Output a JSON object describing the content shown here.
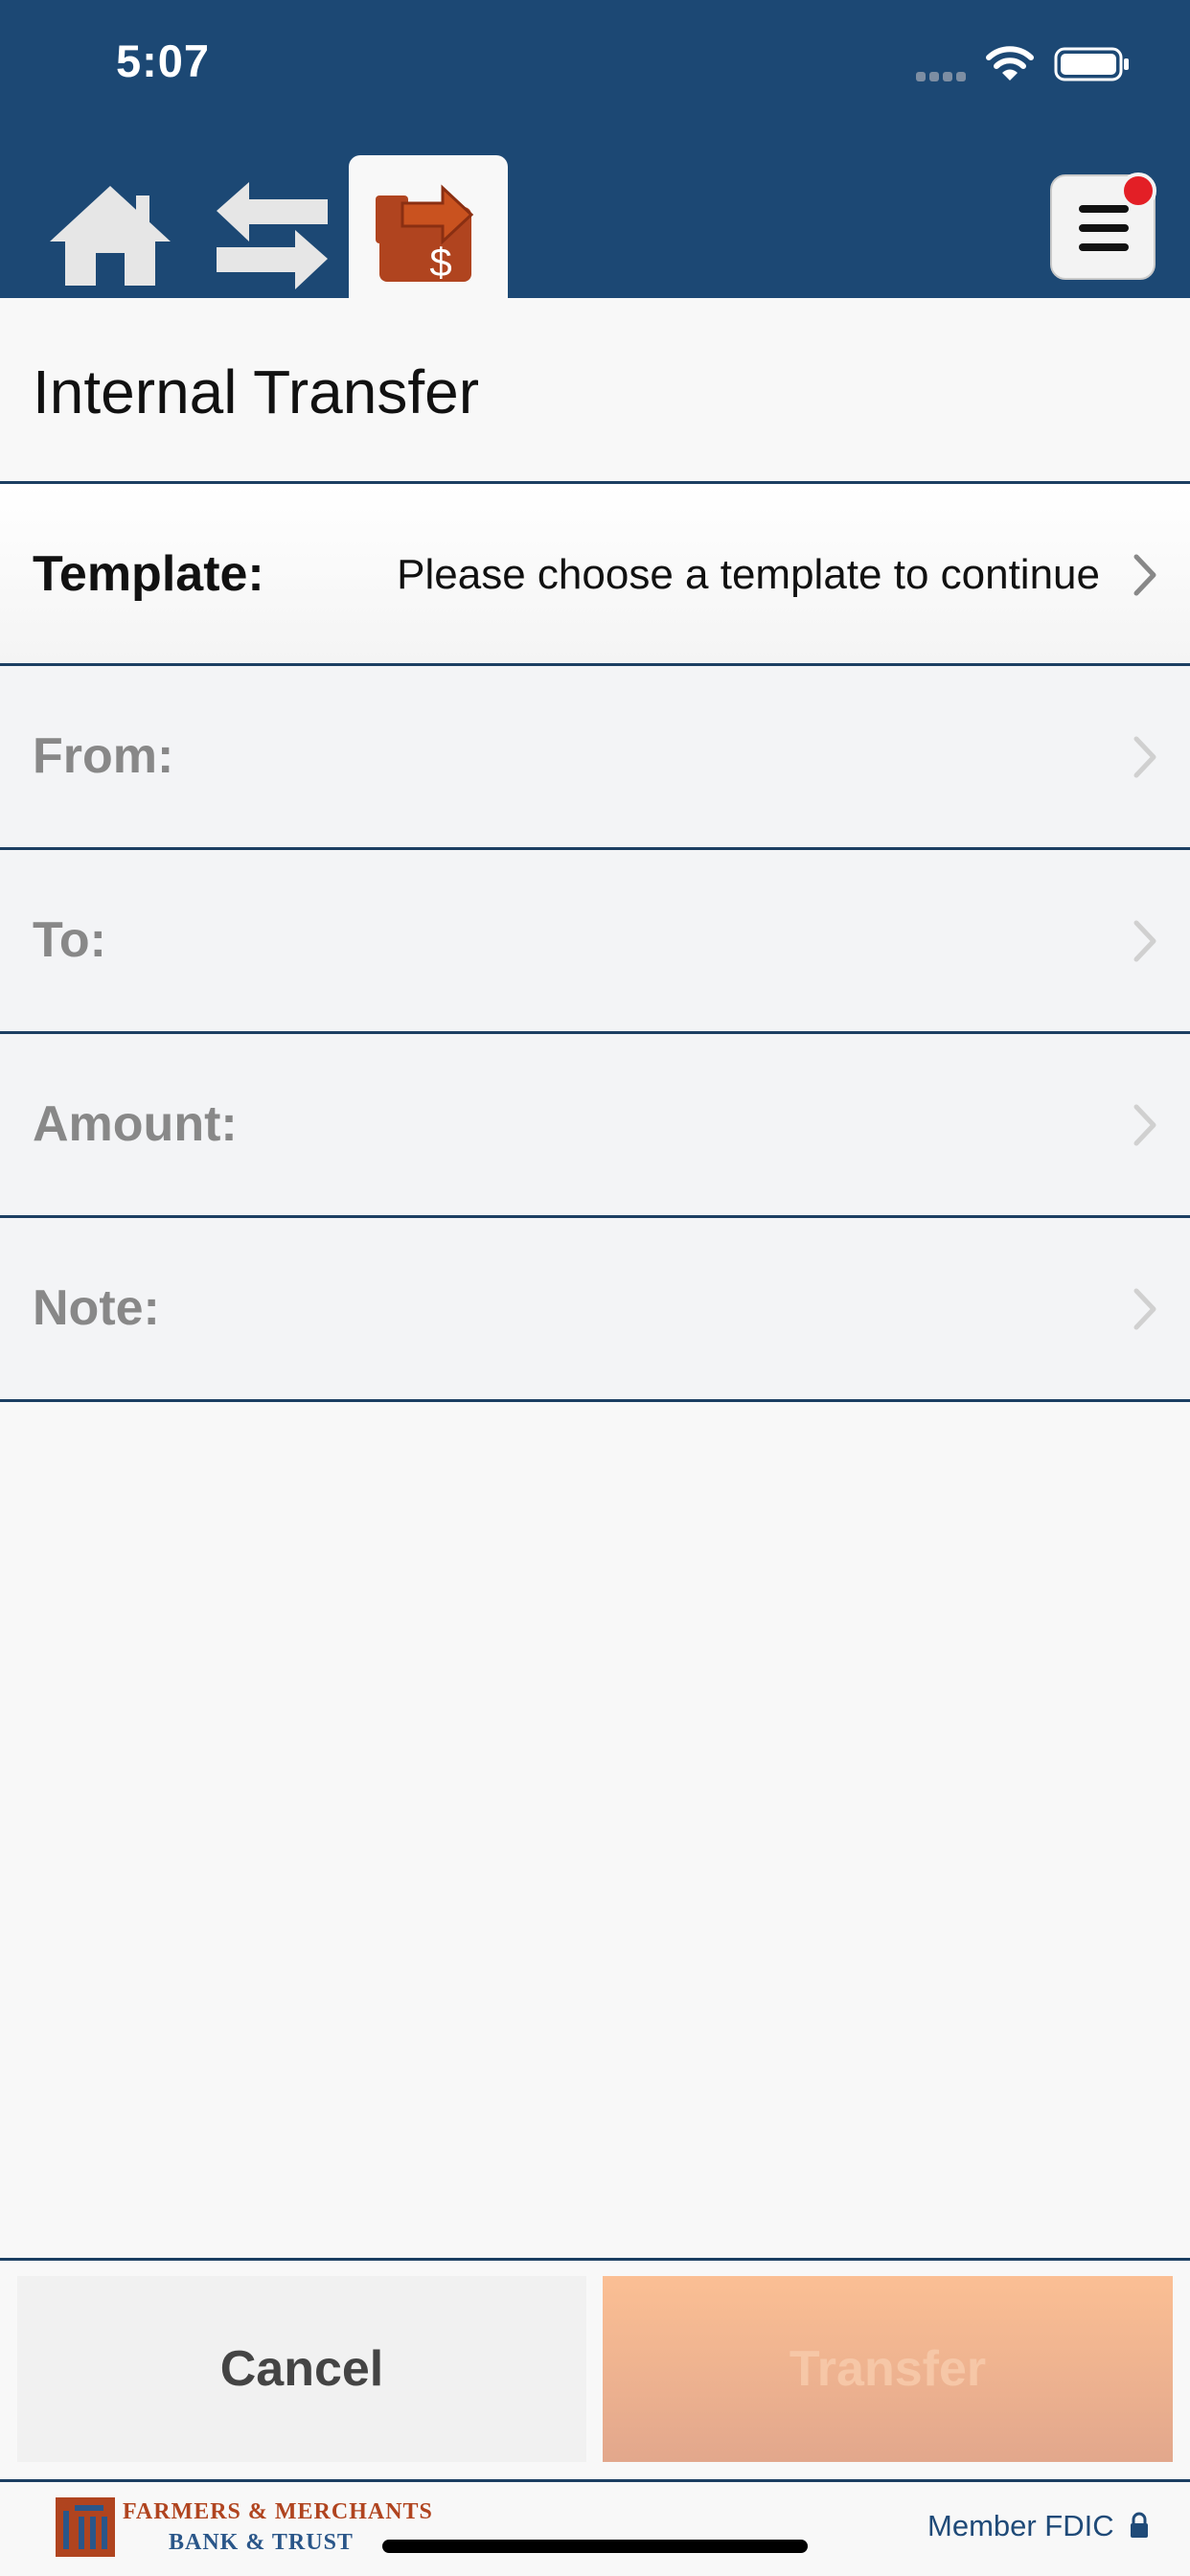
{
  "status_bar": {
    "time": "5:07"
  },
  "nav": {
    "home_icon": "home-icon",
    "transfer_icon": "transfer-arrows-icon",
    "payment_icon": "payment-transfer-icon",
    "menu_icon": "hamburger-menu-icon"
  },
  "page": {
    "title": "Internal Transfer"
  },
  "form": {
    "template": {
      "label": "Template:",
      "value": "Please choose a template to continue"
    },
    "from": {
      "label": "From:",
      "value": ""
    },
    "to": {
      "label": "To:",
      "value": ""
    },
    "amount": {
      "label": "Amount:",
      "value": ""
    },
    "note": {
      "label": "Note:",
      "value": ""
    }
  },
  "actions": {
    "cancel_label": "Cancel",
    "transfer_label": "Transfer"
  },
  "footer": {
    "logo_line1": "FARMERS & MERCHANTS",
    "logo_line2": "BANK & TRUST",
    "fdic": "Member FDIC"
  },
  "colors": {
    "header": "#1c4874",
    "accent": "#b0441f",
    "transfer_button": "#f4b792",
    "notification": "#e31f26"
  }
}
